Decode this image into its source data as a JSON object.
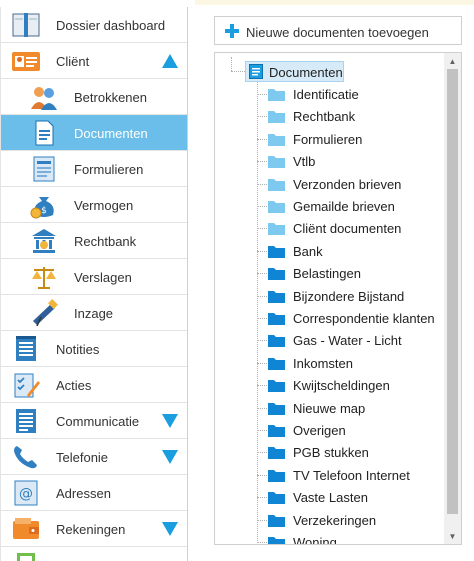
{
  "sidebar": {
    "items": [
      {
        "label": "Dossier dashboard",
        "icon": "book-icon",
        "name": "sidebar-item-dossier-dashboard"
      },
      {
        "label": "Cliënt",
        "icon": "client-icon",
        "name": "sidebar-item-client",
        "arrow": "up"
      },
      {
        "label": "Betrokkenen",
        "icon": "people-icon",
        "name": "sidebar-item-betrokkenen",
        "sub": true
      },
      {
        "label": "Documenten",
        "icon": "document-icon",
        "name": "sidebar-item-documenten",
        "sub": true,
        "active": true
      },
      {
        "label": "Formulieren",
        "icon": "form-icon",
        "name": "sidebar-item-formulieren",
        "sub": true
      },
      {
        "label": "Vermogen",
        "icon": "money-bag-icon",
        "name": "sidebar-item-vermogen",
        "sub": true
      },
      {
        "label": "Rechtbank",
        "icon": "courthouse-icon",
        "name": "sidebar-item-rechtbank",
        "sub": true
      },
      {
        "label": "Verslagen",
        "icon": "scales-icon",
        "name": "sidebar-item-verslagen",
        "sub": true
      },
      {
        "label": "Inzage",
        "icon": "telescope-icon",
        "name": "sidebar-item-inzage",
        "sub": true
      },
      {
        "label": "Notities",
        "icon": "notepad-icon",
        "name": "sidebar-item-notities"
      },
      {
        "label": "Acties",
        "icon": "checklist-icon",
        "name": "sidebar-item-acties"
      },
      {
        "label": "Communicatie",
        "icon": "document-lines-icon",
        "name": "sidebar-item-communicatie",
        "arrow": "down"
      },
      {
        "label": "Telefonie",
        "icon": "phone-icon",
        "name": "sidebar-item-telefonie",
        "arrow": "down"
      },
      {
        "label": "Adressen",
        "icon": "at-sign-icon",
        "name": "sidebar-item-adressen"
      },
      {
        "label": "Rekeningen",
        "icon": "wallet-icon",
        "name": "sidebar-item-rekeningen",
        "arrow": "down"
      },
      {
        "label": "",
        "icon": "calculator-icon",
        "name": "sidebar-item-partial"
      }
    ]
  },
  "toolbar": {
    "add_label": "Nieuwe documenten toevoegen"
  },
  "tree": {
    "root_label": "Documenten",
    "folders": [
      {
        "label": "Identificatie",
        "color": "light"
      },
      {
        "label": "Rechtbank",
        "color": "light"
      },
      {
        "label": "Formulieren",
        "color": "light"
      },
      {
        "label": "Vtlb",
        "color": "light"
      },
      {
        "label": "Verzonden brieven",
        "color": "light"
      },
      {
        "label": "Gemailde brieven",
        "color": "light"
      },
      {
        "label": "Cliënt documenten",
        "color": "light"
      },
      {
        "label": "Bank",
        "color": "dark"
      },
      {
        "label": "Belastingen",
        "color": "dark"
      },
      {
        "label": "Bijzondere Bijstand",
        "color": "dark"
      },
      {
        "label": "Correspondentie klanten",
        "color": "dark"
      },
      {
        "label": "Gas - Water - Licht",
        "color": "dark"
      },
      {
        "label": "Inkomsten",
        "color": "dark"
      },
      {
        "label": "Kwijtscheldingen",
        "color": "dark"
      },
      {
        "label": "Nieuwe map",
        "color": "dark"
      },
      {
        "label": "Overigen",
        "color": "dark"
      },
      {
        "label": "PGB stukken",
        "color": "dark"
      },
      {
        "label": "TV Telefoon Internet",
        "color": "dark"
      },
      {
        "label": "Vaste Lasten",
        "color": "dark"
      },
      {
        "label": "Verzekeringen",
        "color": "dark"
      },
      {
        "label": "Woning",
        "color": "dark"
      }
    ]
  },
  "colors": {
    "active_bg": "#6bbee9",
    "accent_arrow": "#1a9ee0",
    "folder_light": "#7dc9f0",
    "folder_dark": "#1185d4"
  }
}
